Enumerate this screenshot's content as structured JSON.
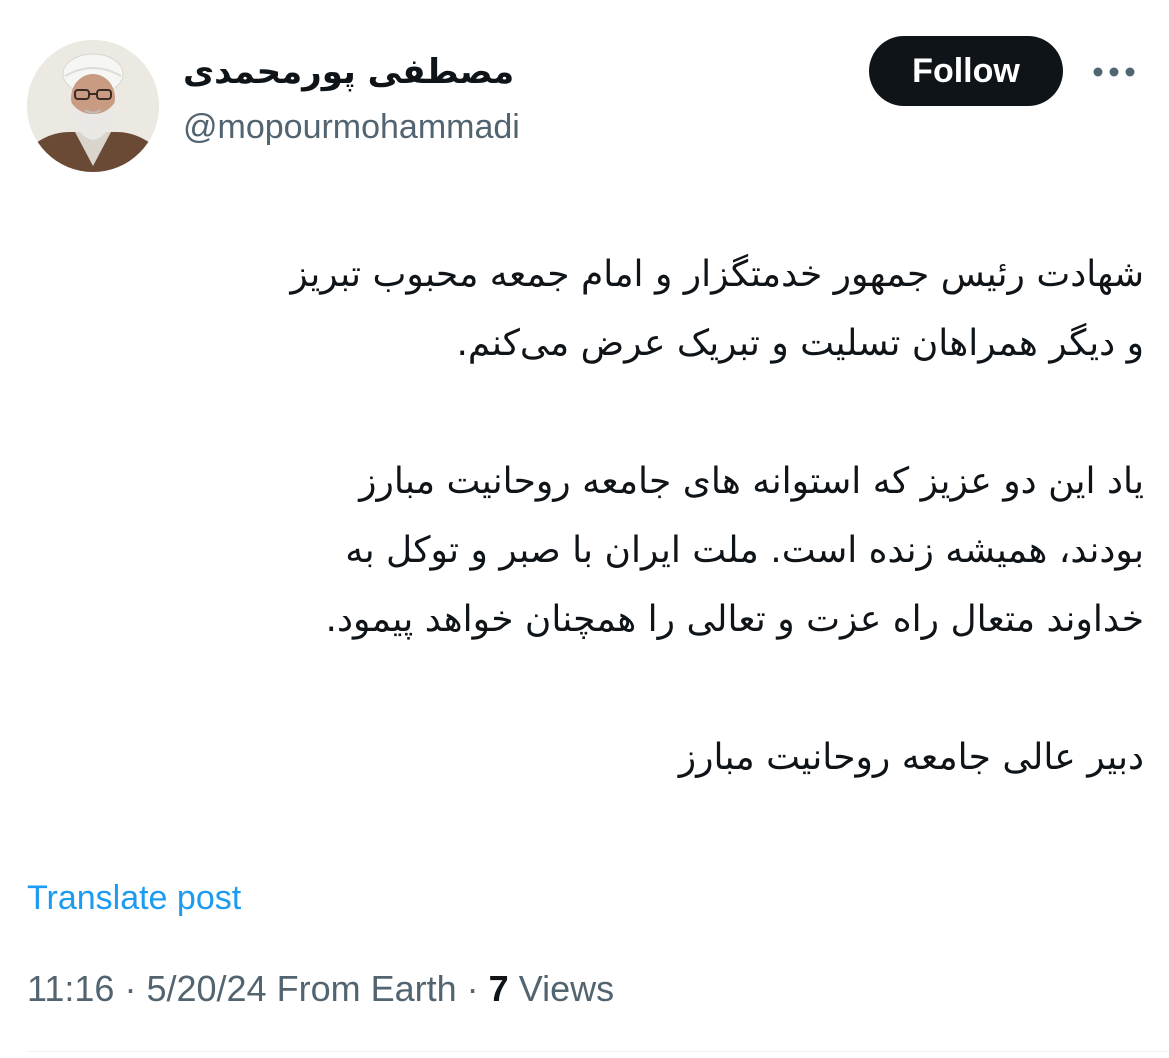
{
  "author": {
    "display_name": "مصطفی پورمحمدی",
    "handle": "@mopourmohammadi"
  },
  "header": {
    "follow_label": "Follow",
    "more_icon": "more-horizontal-icon"
  },
  "post": {
    "paragraph_1_line_1": "شهادت رئیس جمهور خدمتگزار و امام جمعه محبوب تبریز",
    "paragraph_1_line_2": "و دیگر همراهان تسلیت و تبریک عرض می‌کنم.",
    "paragraph_2_line_1": "یاد این دو عزیز که استوانه های جامعه روحانیت مبارز",
    "paragraph_2_line_2": "بودند، همیشه زنده است. ملت ایران با صبر و توکل به",
    "paragraph_2_line_3": "خداوند متعال راه عزت و تعالی را همچنان خواهد پیمود.",
    "paragraph_3_line_1": "دبیر عالی جامعه روحانیت مبارز"
  },
  "translate_label": "Translate post",
  "meta": {
    "time": "11:16",
    "separator": "·",
    "date": "5/20/24",
    "source": "From Earth",
    "views_count": "7",
    "views_label": "Views"
  },
  "colors": {
    "text": "#0f1419",
    "secondary": "#536471",
    "link": "#1d9bf0",
    "button_bg": "#0f1419"
  }
}
